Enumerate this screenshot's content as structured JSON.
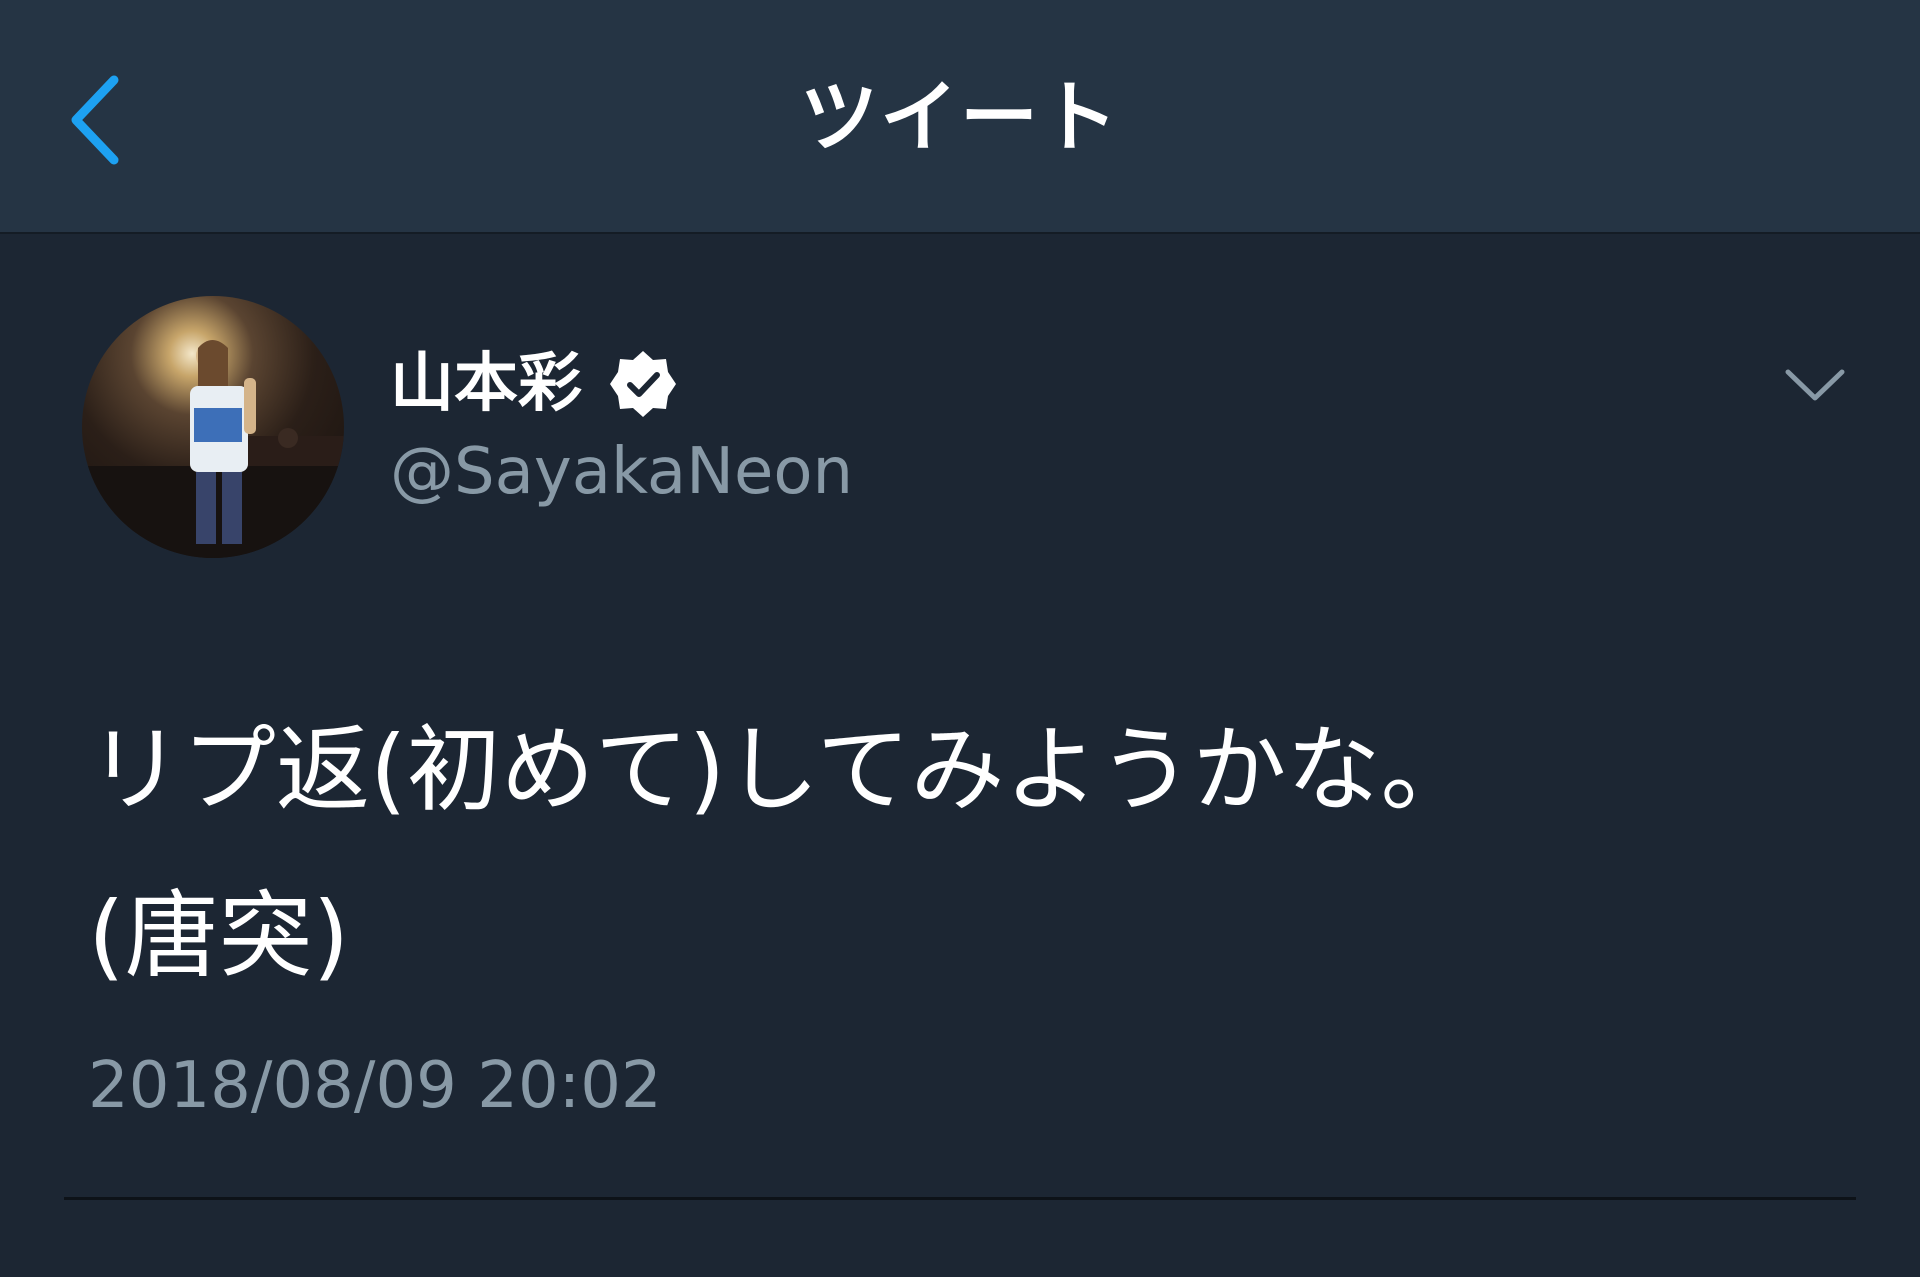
{
  "header": {
    "title": "ツイート",
    "back_icon": "chevron-left-icon"
  },
  "tweet": {
    "display_name": "山本彩",
    "verified_icon": "verified-badge-icon",
    "handle": "@SayakaNeon",
    "menu_icon": "chevron-down-icon",
    "text": "リプ返(初めて)してみようかな。\n(唐突)",
    "timestamp": "2018/08/09 20:02"
  },
  "colors": {
    "background": "#1c2633",
    "header_background": "#253444",
    "accent": "#1da1f2",
    "secondary_text": "#8899a6",
    "primary_text": "#ffffff"
  }
}
